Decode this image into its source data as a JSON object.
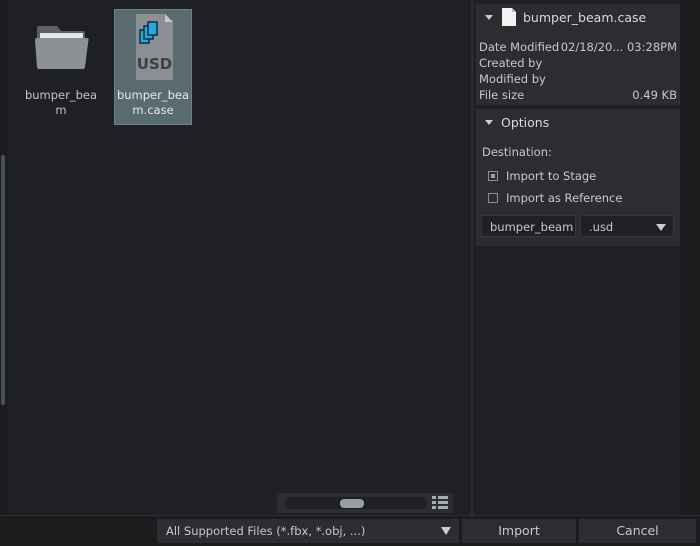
{
  "files": [
    {
      "name": "bumper_beam",
      "type": "folder",
      "selected": false
    },
    {
      "name": "bumper_beam.case",
      "type": "usd",
      "selected": true,
      "icon_text": "USD"
    }
  ],
  "info": {
    "filename": "bumper_beam.case",
    "rows": [
      {
        "label": "Date Modified",
        "value": "02/18/20... 03:28PM"
      },
      {
        "label": "Created by",
        "value": ""
      },
      {
        "label": "Modified by",
        "value": ""
      },
      {
        "label": "File size",
        "value": "0.49 KB"
      }
    ]
  },
  "options": {
    "title": "Options",
    "destination_label": "Destination:",
    "import_to_stage": "Import to Stage",
    "import_as_reference": "Import as Reference",
    "name_value": "bumper_beam",
    "extension": ".usd"
  },
  "bottom": {
    "filter": "All Supported Files (*.fbx, *.obj, ...)",
    "import": "Import",
    "cancel": "Cancel"
  },
  "colors": {
    "selection": "#5a6b70",
    "usd_blue": "#29a8e0"
  }
}
